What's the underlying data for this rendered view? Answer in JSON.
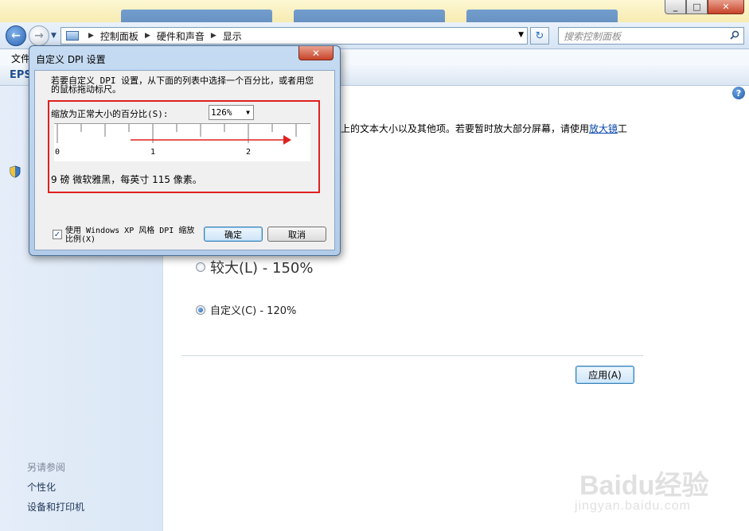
{
  "window": {
    "address": {
      "crumbs": [
        "控制面板",
        "硬件和声音",
        "显示"
      ]
    },
    "search": {
      "placeholder": "搜索控制面板"
    },
    "menubar": {
      "file": "文件"
    },
    "cmdbar": {
      "label": "EPS"
    },
    "sidebar": {
      "see_also_title": "另请参阅",
      "links": [
        "个性化",
        "设备和打印机"
      ]
    },
    "content": {
      "desc_text": "上的文本大小以及其他项。若要暂时放大部分屏幕，请使用",
      "magnifier_link": "放大镜",
      "desc_suffix": "工",
      "options": [
        {
          "label": "较大(L) - 150%",
          "checked": false
        },
        {
          "label": "自定义(C) - 120%",
          "checked": true
        }
      ],
      "apply_label": "应用(A)"
    }
  },
  "dialog": {
    "title": "自定义 DPI 设置",
    "instruction": "若要自定义 DPI 设置，从下面的列表中选择一个百分比，或者用您的鼠标拖动标尺。",
    "scale_label": "缩放为正常大小的百分比(S):",
    "scale_value": "126%",
    "ruler_numbers": [
      "0",
      "1",
      "2"
    ],
    "sample_text": "9 磅 微软雅黑，每英寸 115 像素。",
    "xp_scaling_label": "使用 Windows XP 风格 DPI 缩放比例(X)",
    "xp_scaling_checked": true,
    "ok_label": "确定",
    "cancel_label": "取消"
  },
  "watermark": {
    "line1": "Baidu经验",
    "line2": "jingyan.baidu.com"
  },
  "colors": {
    "annotation_red": "#e02020",
    "link_blue": "#0645ad"
  }
}
